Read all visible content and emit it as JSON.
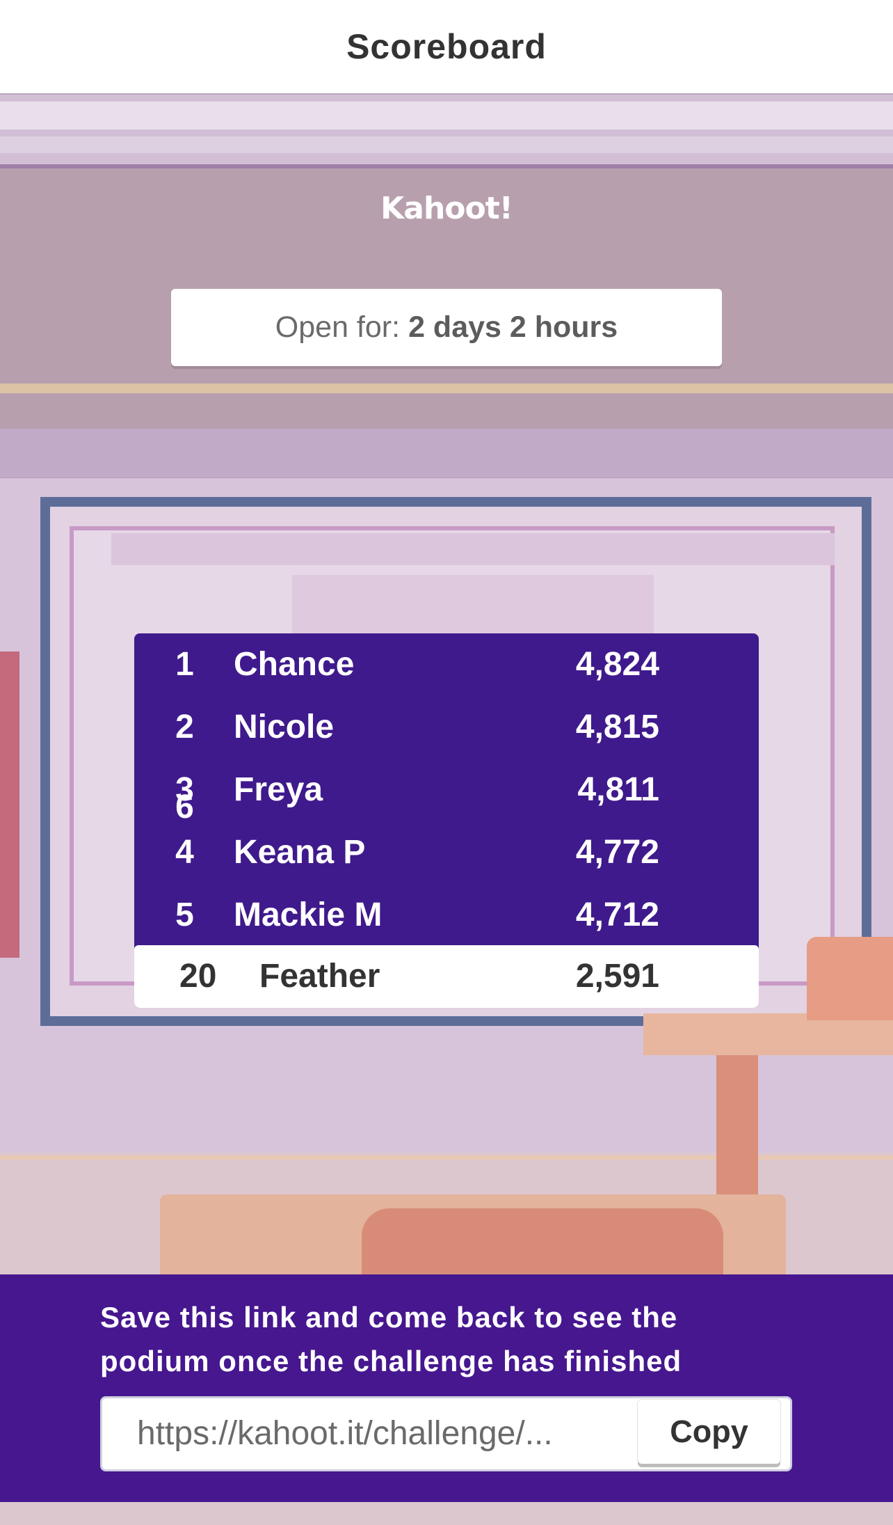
{
  "header": {
    "title": "Scoreboard"
  },
  "logo": {
    "text": "Kahoot!"
  },
  "status": {
    "open_label": "Open for:",
    "open_value": "2 days 2 hours"
  },
  "scoreboard": {
    "rows": [
      {
        "rank": "1",
        "name": "Chance",
        "score": "4,824"
      },
      {
        "rank": "2",
        "name": "Nicole",
        "score": "4,815"
      },
      {
        "rank": "3",
        "rank_extra": "6",
        "name": "Freya",
        "score": "4,811"
      },
      {
        "rank": "4",
        "name": "Keana P",
        "score": "4,772"
      },
      {
        "rank": "5",
        "name": "Mackie M",
        "score": "4,712"
      }
    ],
    "own": {
      "rank": "20",
      "name": "Feather",
      "score": "2,591"
    }
  },
  "footer": {
    "message": "Save this link and come back to see the podium once the challenge has finished",
    "link": "https://kahoot.it/challenge/...",
    "copy_label": "Copy"
  },
  "colors": {
    "brand_purple": "#46178f",
    "board_purple": "#3f1a8c"
  }
}
